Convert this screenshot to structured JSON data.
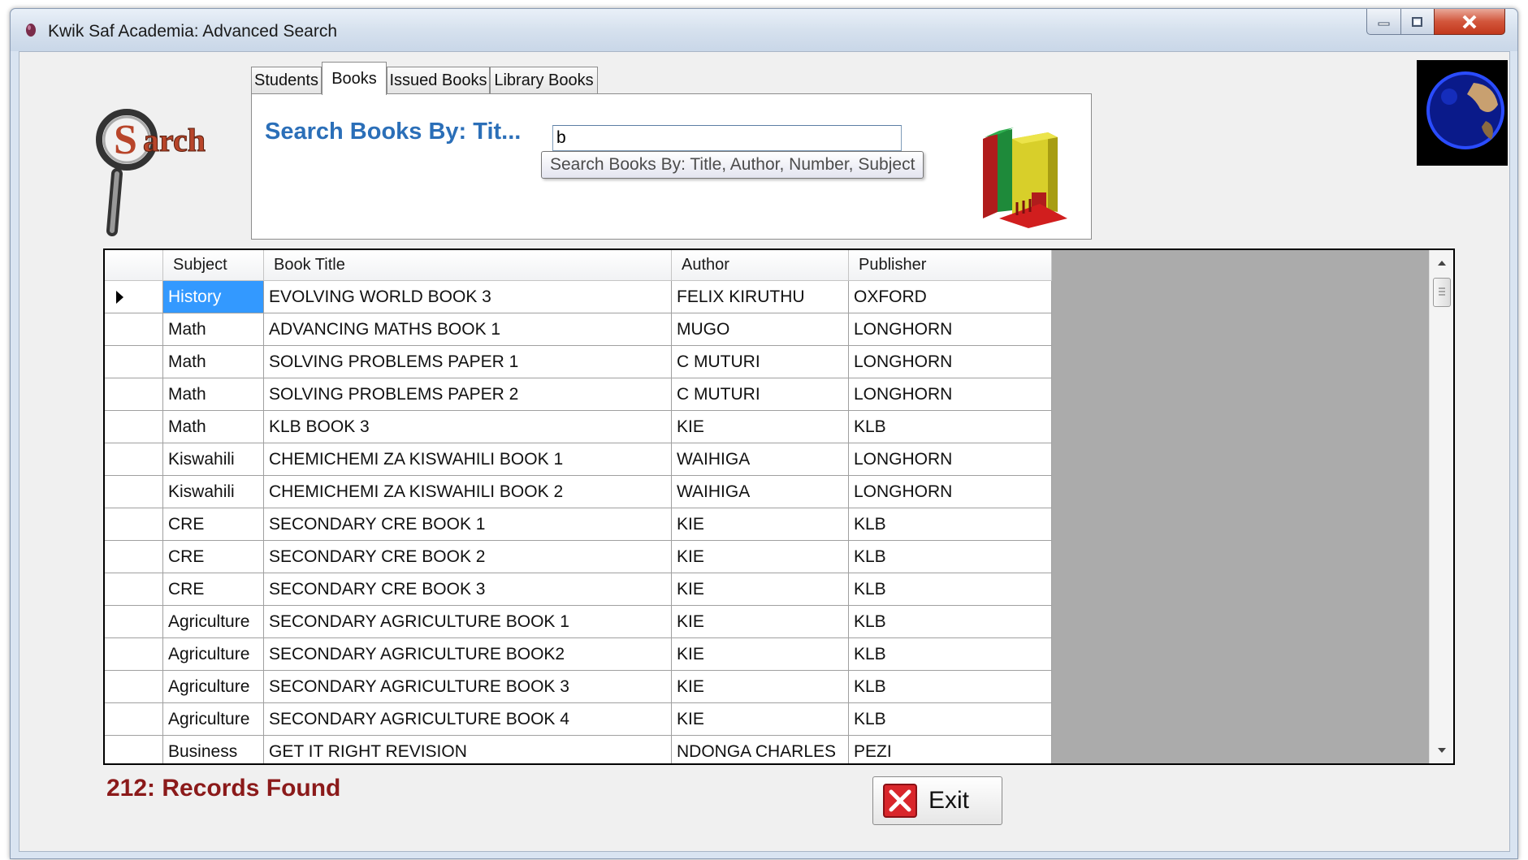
{
  "window": {
    "title": "Kwik Saf Academia: Advanced Search"
  },
  "tabs": [
    {
      "label": "Students"
    },
    {
      "label": "Books"
    },
    {
      "label": "Issued Books"
    },
    {
      "label": "Library Books"
    }
  ],
  "active_tab": "Books",
  "search": {
    "label": "Search Books By: Tit...",
    "value": "b",
    "tooltip": "Search Books By: Title, Author, Number, Subject"
  },
  "grid": {
    "columns": [
      "Subject",
      "Book Title",
      "Author",
      "Publisher"
    ],
    "rows": [
      [
        "History",
        "EVOLVING WORLD BOOK 3",
        "FELIX KIRUTHU",
        "OXFORD"
      ],
      [
        "Math",
        "ADVANCING MATHS BOOK 1",
        "MUGO",
        "LONGHORN"
      ],
      [
        "Math",
        "SOLVING PROBLEMS PAPER 1",
        "C MUTURI",
        "LONGHORN"
      ],
      [
        "Math",
        "SOLVING PROBLEMS PAPER 2",
        "C MUTURI",
        "LONGHORN"
      ],
      [
        "Math",
        "KLB BOOK 3",
        "KIE",
        "KLB"
      ],
      [
        "Kiswahili",
        "CHEMICHEMI ZA KISWAHILI BOOK 1",
        "WAIHIGA",
        "LONGHORN"
      ],
      [
        "Kiswahili",
        "CHEMICHEMI ZA KISWAHILI BOOK 2",
        "WAIHIGA",
        "LONGHORN"
      ],
      [
        "CRE",
        "SECONDARY CRE BOOK 1",
        "KIE",
        "KLB"
      ],
      [
        "CRE",
        "SECONDARY CRE BOOK 2",
        "KIE",
        "KLB"
      ],
      [
        "CRE",
        "SECONDARY CRE BOOK 3",
        "KIE",
        "KLB"
      ],
      [
        "Agriculture",
        "SECONDARY AGRICULTURE BOOK 1",
        "KIE",
        "KLB"
      ],
      [
        "Agriculture",
        "SECONDARY AGRICULTURE BOOK2",
        "KIE",
        "KLB"
      ],
      [
        "Agriculture",
        "SECONDARY AGRICULTURE BOOK 3",
        "KIE",
        "KLB"
      ],
      [
        "Agriculture",
        "SECONDARY AGRICULTURE BOOK 4",
        "KIE",
        "KLB"
      ],
      [
        "Business",
        "GET IT RIGHT REVISION",
        "NDONGA CHARLES",
        "PEZI"
      ]
    ],
    "selected_row": 0
  },
  "status": {
    "records_found": "212:  Records Found"
  },
  "buttons": {
    "exit_label": "Exit"
  },
  "icons": {
    "app": "app-icon",
    "search_logo": "search-logo-icon",
    "globe": "globe-icon",
    "books": "books-icon",
    "exit": "close-icon"
  },
  "colors": {
    "search_label": "#2b6fb8",
    "records_text": "#8b1a1a",
    "selection": "#3399ff",
    "exit_icon": "#d9262b"
  }
}
